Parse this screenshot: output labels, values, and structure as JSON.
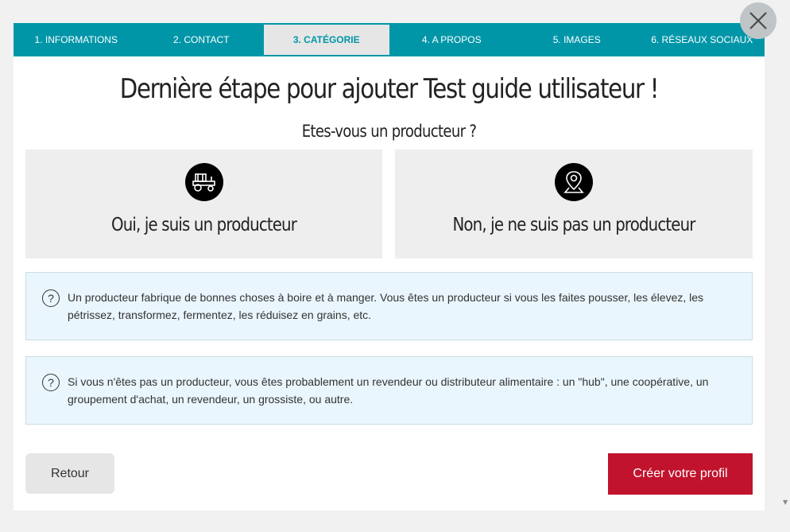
{
  "tabs": [
    {
      "label": "1. INFORMATIONS"
    },
    {
      "label": "2. CONTACT"
    },
    {
      "label": "3. CATÉGORIE"
    },
    {
      "label": "4. A PROPOS"
    },
    {
      "label": "5. IMAGES"
    },
    {
      "label": "6. RÉSEAUX SOCIAUX"
    }
  ],
  "active_tab": "3. CATÉGORIE",
  "title": "Dernière étape pour ajouter Test guide utilisateur !",
  "subtitle": "Etes-vous un producteur ?",
  "choices": {
    "yes": {
      "label": "Oui, je suis un producteur",
      "icon": "tractor-icon"
    },
    "no": {
      "label": "Non, je ne suis pas un producteur",
      "icon": "map-pin-icon"
    }
  },
  "info": {
    "producer_text": "Un producteur fabrique de bonnes choses à boire et à manger. Vous êtes un producteur si vous les faites pousser, les élevez, les pétrissez, transformez, fermentez, les réduisez en grains, etc.",
    "non_producer_text": "Si vous n'êtes pas un producteur, vous êtes probablement un revendeur ou distributeur alimentaire : un \"hub\", une coopérative, un groupement d'achat, un revendeur, un grossiste, ou autre.",
    "question_glyph": "?"
  },
  "buttons": {
    "back": "Retour",
    "create": "Créer votre profil"
  },
  "colors": {
    "tab_bar": "#0096a8",
    "create_button": "#c1132d",
    "info_bg": "#eaf6fd"
  }
}
